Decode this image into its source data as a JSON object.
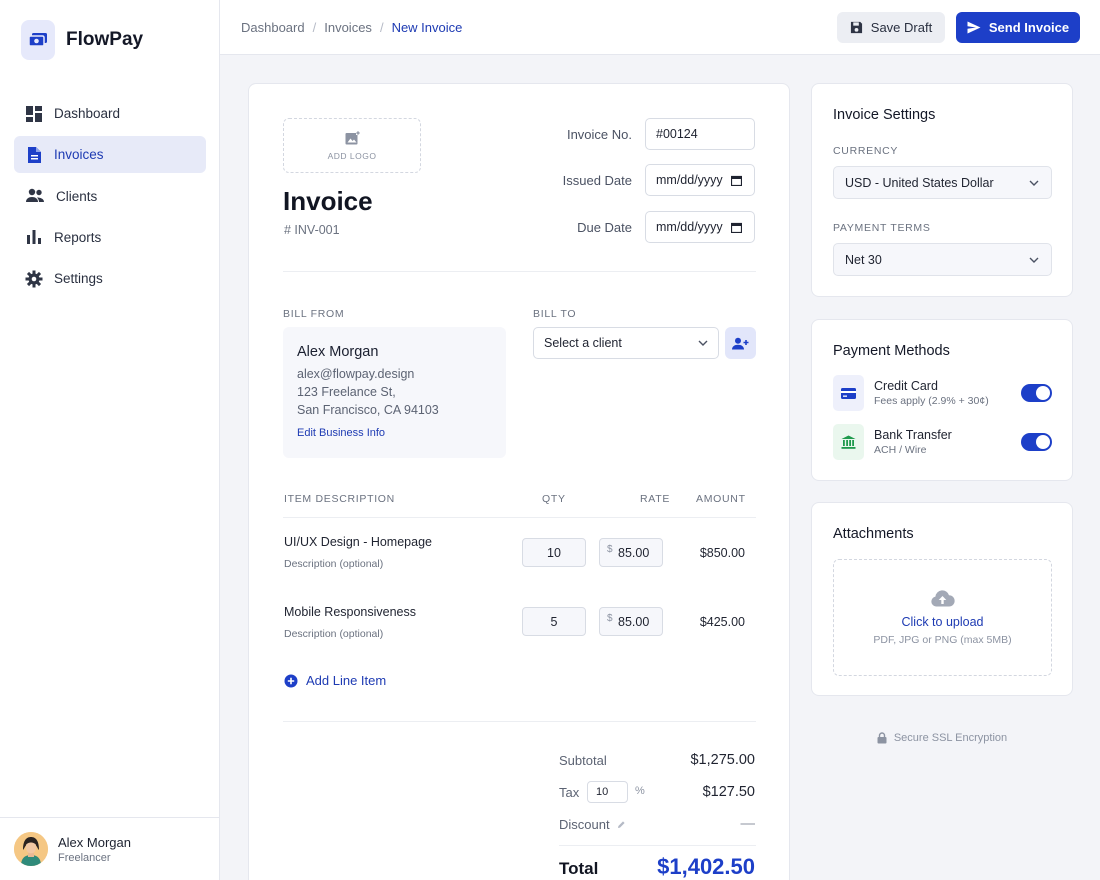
{
  "app": {
    "name": "FlowPay"
  },
  "sidebar": {
    "items": [
      {
        "label": "Dashboard",
        "icon": "dashboard-icon"
      },
      {
        "label": "Invoices",
        "icon": "document-icon",
        "active": true
      },
      {
        "label": "Clients",
        "icon": "people-icon"
      },
      {
        "label": "Reports",
        "icon": "bar-chart-icon"
      },
      {
        "label": "Settings",
        "icon": "gear-icon"
      }
    ],
    "user": {
      "name": "Alex Morgan",
      "role": "Freelancer"
    }
  },
  "topbar": {
    "breadcrumb": [
      "Dashboard",
      "Invoices",
      "New Invoice"
    ],
    "save_draft_label": "Save Draft",
    "send_invoice_label": "Send Invoice"
  },
  "invoice": {
    "add_logo_label": "ADD LOGO",
    "title": "Invoice",
    "number_display": "# INV-001",
    "meta": {
      "invoice_no_label": "Invoice No.",
      "invoice_no_value": "#00124",
      "issued_date_label": "Issued Date",
      "issued_date_placeholder": "mm/dd/yyyy",
      "due_date_label": "Due Date",
      "due_date_placeholder": "mm/dd/yyyy"
    },
    "bill_from": {
      "label": "BILL FROM",
      "name": "Alex Morgan",
      "email": "alex@flowpay.design",
      "address_line1": "123 Freelance St,",
      "address_line2": "San Francisco, CA 94103",
      "edit_label": "Edit Business Info"
    },
    "bill_to": {
      "label": "BILL TO",
      "select_placeholder": "Select a client"
    },
    "items_header": {
      "description": "ITEM DESCRIPTION",
      "qty": "QTY",
      "rate": "RATE",
      "amount": "AMOUNT"
    },
    "items": [
      {
        "title": "UI/UX Design - Homepage",
        "description_placeholder": "Description (optional)",
        "qty": "10",
        "currency_symbol": "$",
        "rate": "85.00",
        "amount": "$850.00"
      },
      {
        "title": "Mobile Responsiveness",
        "description_placeholder": "Description (optional)",
        "qty": "5",
        "currency_symbol": "$",
        "rate": "85.00",
        "amount": "$425.00"
      }
    ],
    "add_line_label": "Add Line Item",
    "totals": {
      "subtotal_label": "Subtotal",
      "subtotal_value": "$1,275.00",
      "tax_label": "Tax",
      "tax_rate": "10",
      "tax_unit": "%",
      "tax_value": "$127.50",
      "discount_label": "Discount",
      "discount_value": "—",
      "total_label": "Total",
      "total_value": "$1,402.50"
    }
  },
  "settings": {
    "title": "Invoice Settings",
    "currency_label": "CURRENCY",
    "currency_value": "USD - United States Dollar",
    "terms_label": "PAYMENT TERMS",
    "terms_value": "Net 30"
  },
  "payment_methods": {
    "title": "Payment Methods",
    "methods": [
      {
        "name": "Credit Card",
        "sub": "Fees apply (2.9% + 30¢)",
        "icon": "credit-card-icon",
        "enabled": true
      },
      {
        "name": "Bank Transfer",
        "sub": "ACH / Wire",
        "icon": "bank-icon",
        "enabled": true
      }
    ]
  },
  "attachments": {
    "title": "Attachments",
    "upload_label": "Click to upload",
    "upload_hint": "PDF, JPG or PNG (max 5MB)"
  },
  "footer": {
    "ssl_label": "Secure SSL Encryption"
  },
  "colors": {
    "accent": "#1d3fc8",
    "accent_text": "#1e3bb3",
    "active_bg": "#e7eaf8",
    "page_bg": "#f3f4f8"
  }
}
